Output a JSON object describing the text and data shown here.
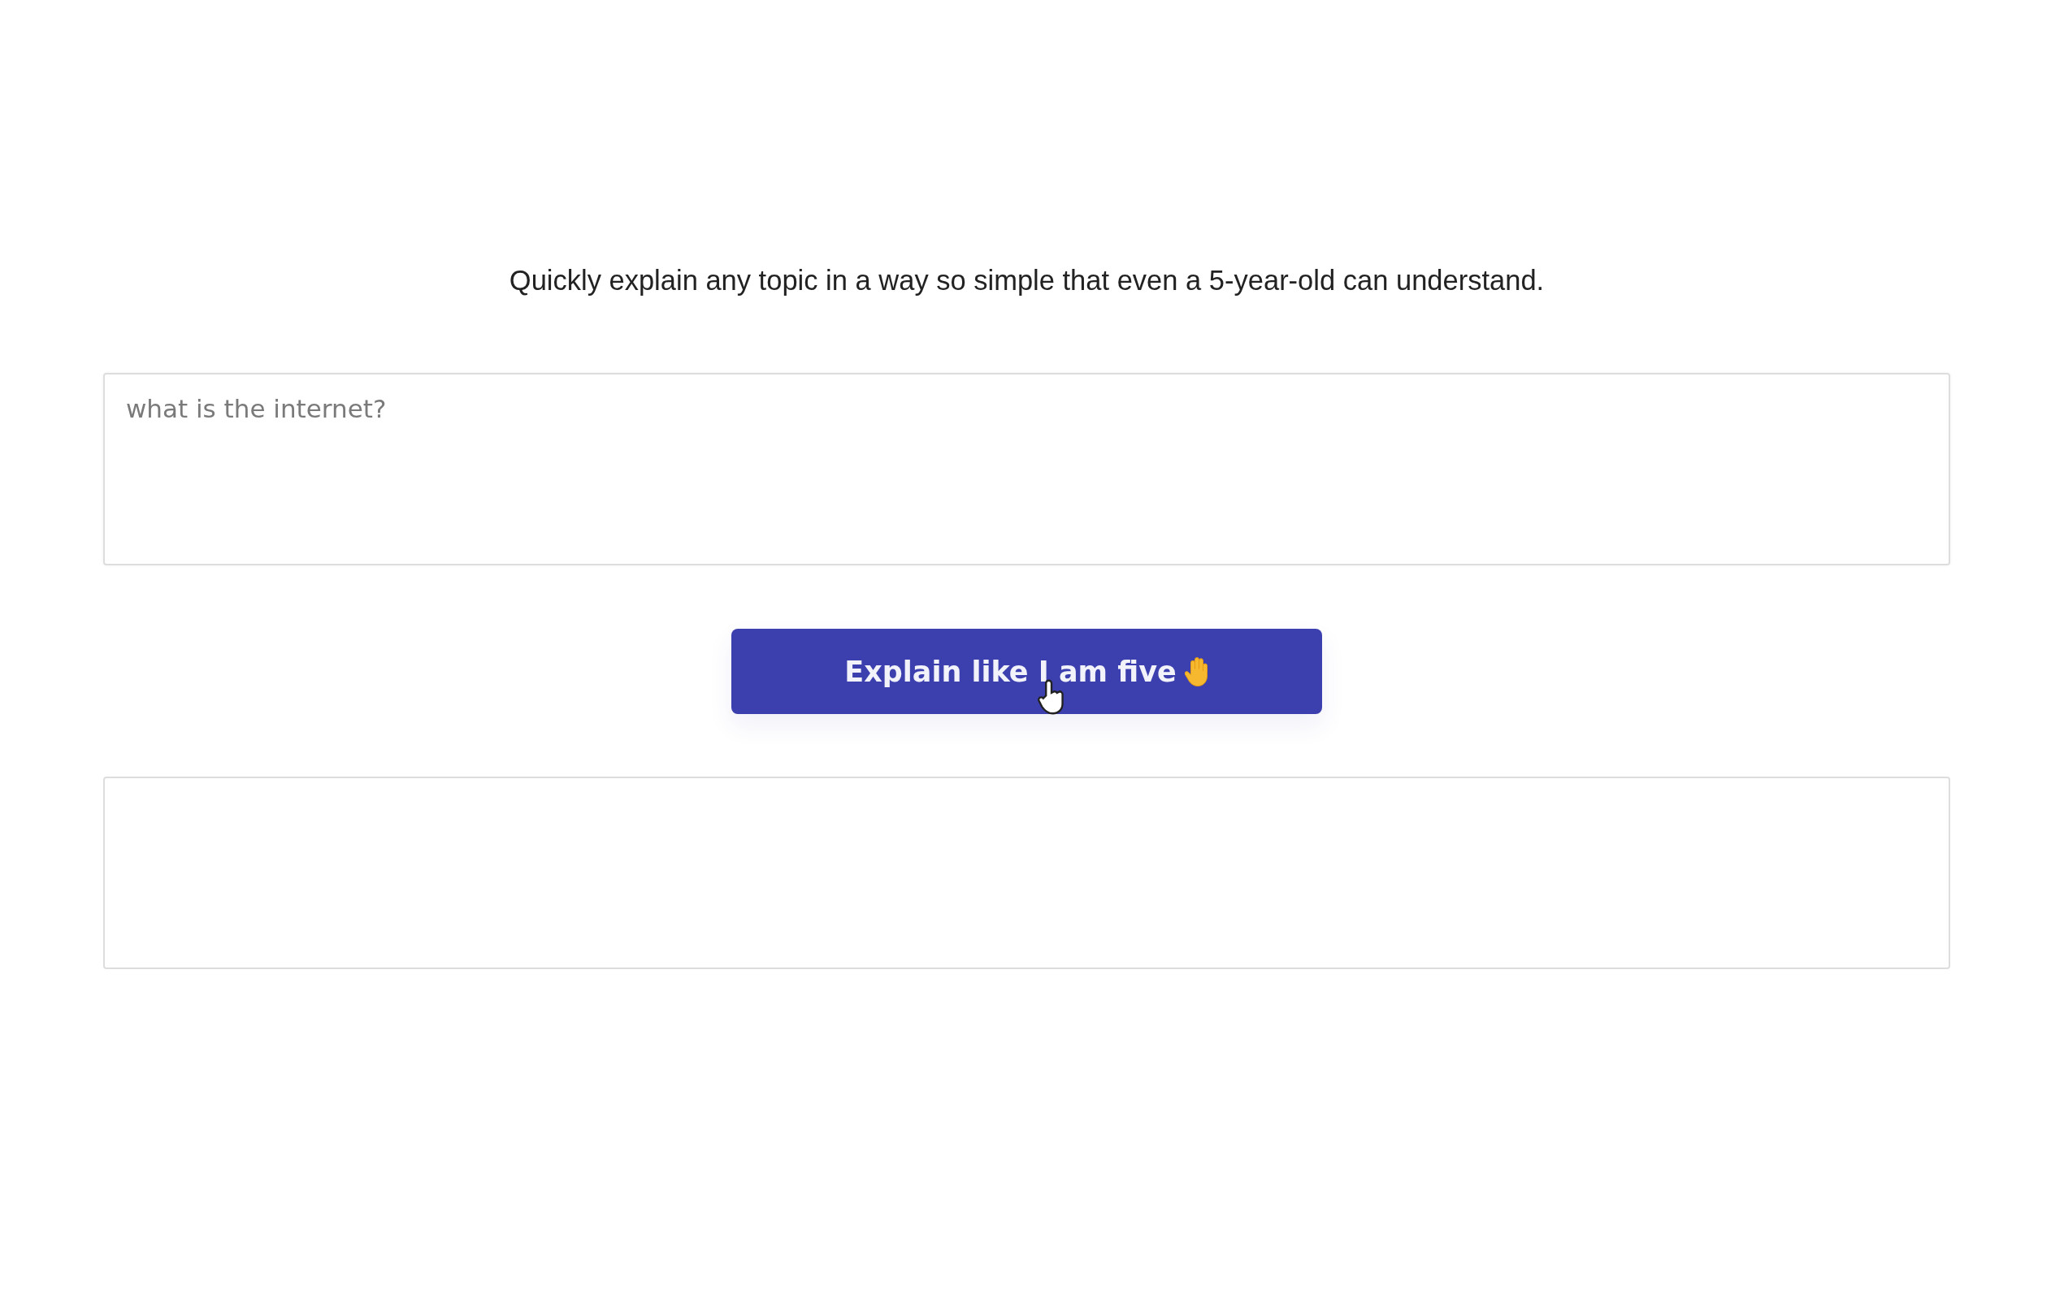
{
  "description": "Quickly explain any topic in a way so simple that even a 5-year-old can understand.",
  "question_field": {
    "placeholder": "what is the internet?"
  },
  "explain_button": {
    "label": "Explain like I am five"
  }
}
